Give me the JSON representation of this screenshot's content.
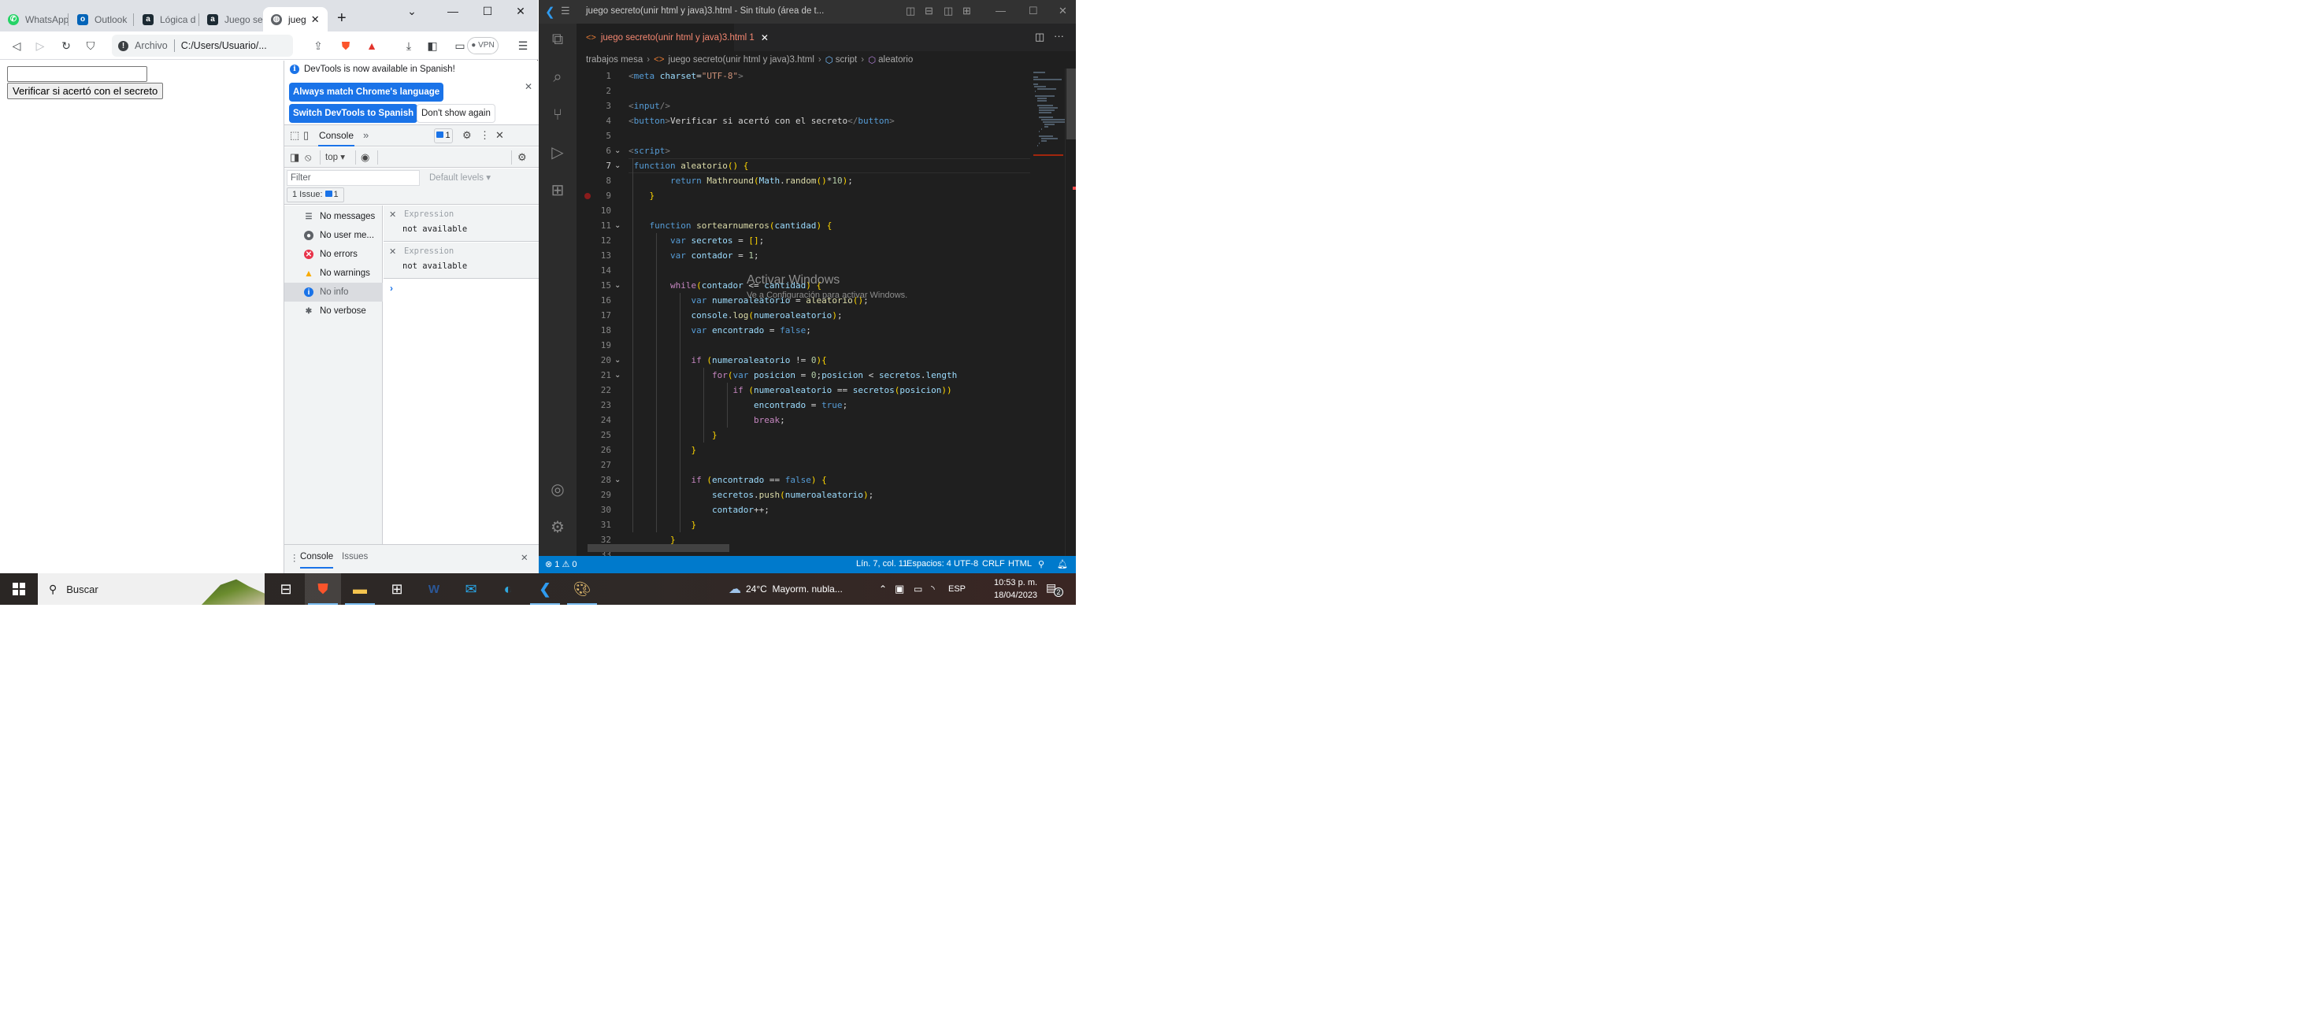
{
  "browser": {
    "tabs": [
      {
        "label": "WhatsApp",
        "icon": "whatsapp-icon",
        "color": "#25d366"
      },
      {
        "label": "Outlook",
        "icon": "outlook-icon",
        "color": "#0364b8"
      },
      {
        "label": "Lógica d",
        "icon": "alura-icon",
        "color": "#1c2a33"
      },
      {
        "label": "Juego se",
        "icon": "alura-icon",
        "color": "#1c2a33"
      },
      {
        "label": "jueg",
        "icon": "globe-icon",
        "color": "#5f6368",
        "active": true
      }
    ],
    "new_tab": "+",
    "address": {
      "protocol_label": "Archivo",
      "url": "C:/Users/Usuario/..."
    },
    "vpn_label": "VPN",
    "page": {
      "input_value": "",
      "button_label": "Verificar si acertó con el secreto"
    }
  },
  "devtools": {
    "infobar": {
      "message": "DevTools is now available in Spanish!",
      "btn_always": "Always match Chrome's language",
      "btn_switch": "Switch DevTools to Spanish",
      "btn_dont": "Don't show again"
    },
    "tabs": {
      "console": "Console",
      "more": "»",
      "issues_count": "1"
    },
    "context": "top",
    "filter_placeholder": "Filter",
    "levels": "Default levels",
    "issues_chip": {
      "label": "1 Issue:",
      "count": "1"
    },
    "sidebar": [
      {
        "label": "No messages",
        "icon": "list-icon"
      },
      {
        "label": "No user me...",
        "icon": "user-icon"
      },
      {
        "label": "No errors",
        "icon": "error-icon"
      },
      {
        "label": "No warnings",
        "icon": "warning-icon"
      },
      {
        "label": "No info",
        "icon": "info-icon",
        "selected": true
      },
      {
        "label": "No verbose",
        "icon": "bug-icon"
      }
    ],
    "expressions": [
      {
        "label": "Expression",
        "value": "not available"
      },
      {
        "label": "Expression",
        "value": "not available"
      }
    ],
    "prompt": "›",
    "drawer": {
      "console": "Console",
      "issues": "Issues"
    }
  },
  "vscode": {
    "window_title": "juego secreto(unir html y java)3.html - Sin título (área de t...",
    "tab": {
      "label": "juego secreto(unir html y java)3.html",
      "problems": "1"
    },
    "breadcrumb": [
      "trabajos mesa",
      "juego secreto(unir html y java)3.html",
      "script",
      "aleatorio"
    ],
    "current_line": 7,
    "breakpoint_line": 9,
    "fold_lines": [
      6,
      7,
      11,
      15,
      20,
      21,
      28
    ],
    "lines": [
      "<meta charset=\"UTF-8\">",
      "",
      "<input/>",
      "<button>Verificar si acertó con el secreto</button>",
      "",
      "<script>",
      " function aleatorio() {",
      "        return Mathround(Math.random()*10);",
      "    }",
      "",
      "    function sortearnumeros(cantidad) {",
      "        var secretos = [];",
      "        var contador = 1;",
      "",
      "        while(contador <= cantidad) {",
      "            var numeroaleatorio = aleatorio();",
      "            console.log(numeroaleatorio);",
      "            var encontrado = false;",
      "",
      "            if (numeroaleatorio != 0){",
      "                for(var posicion = 0;posicion < secretos.length",
      "                    if (numeroaleatorio == secretos(posicion))",
      "                        encontrado = true;",
      "                        break;",
      "                }",
      "            }",
      "",
      "            if (encontrado == false) {",
      "                secretos.push(numeroaleatorio);",
      "                contador++;",
      "            }",
      "        }",
      ""
    ],
    "watermark": {
      "title": "Activar Windows",
      "subtitle": "Ve a Configuración para activar Windows."
    },
    "status": {
      "errors": "1",
      "warnings": "0",
      "position": "Lín. 7, col. 11",
      "spaces": "Espacios: 4",
      "encoding": "UTF-8",
      "eol": "CRLF",
      "language": "HTML"
    }
  },
  "taskbar": {
    "search_placeholder": "Buscar",
    "apps": [
      "task-view",
      "brave",
      "file-explorer",
      "microsoft-store",
      "word",
      "mail",
      "edge",
      "vscode",
      "paint"
    ],
    "weather": {
      "temp": "24°C",
      "desc": "Mayorm. nubla..."
    },
    "language": "ESP",
    "time": "10:53 p. m.",
    "date": "18/04/2023",
    "notifications": "2"
  }
}
